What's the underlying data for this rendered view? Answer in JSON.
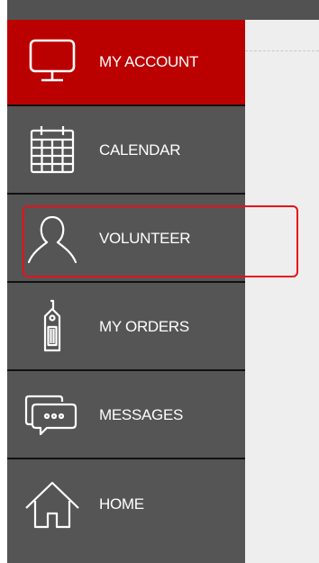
{
  "sidebar": {
    "items": [
      {
        "label": "MY ACCOUNT",
        "icon": "monitor-icon",
        "active": true
      },
      {
        "label": "CALENDAR",
        "icon": "calendar-icon",
        "active": false
      },
      {
        "label": "VOLUNTEER",
        "icon": "person-icon",
        "active": false
      },
      {
        "label": "MY ORDERS",
        "icon": "price-tag-icon",
        "active": false
      },
      {
        "label": "MESSAGES",
        "icon": "chat-bubbles-icon",
        "active": false
      },
      {
        "label": "HOME",
        "icon": "home-icon",
        "active": false
      }
    ]
  },
  "colors": {
    "sidebar_bg": "#555555",
    "active_bg": "#bb0000",
    "highlight_border": "#e8101a",
    "content_bg": "#eeeeee"
  }
}
